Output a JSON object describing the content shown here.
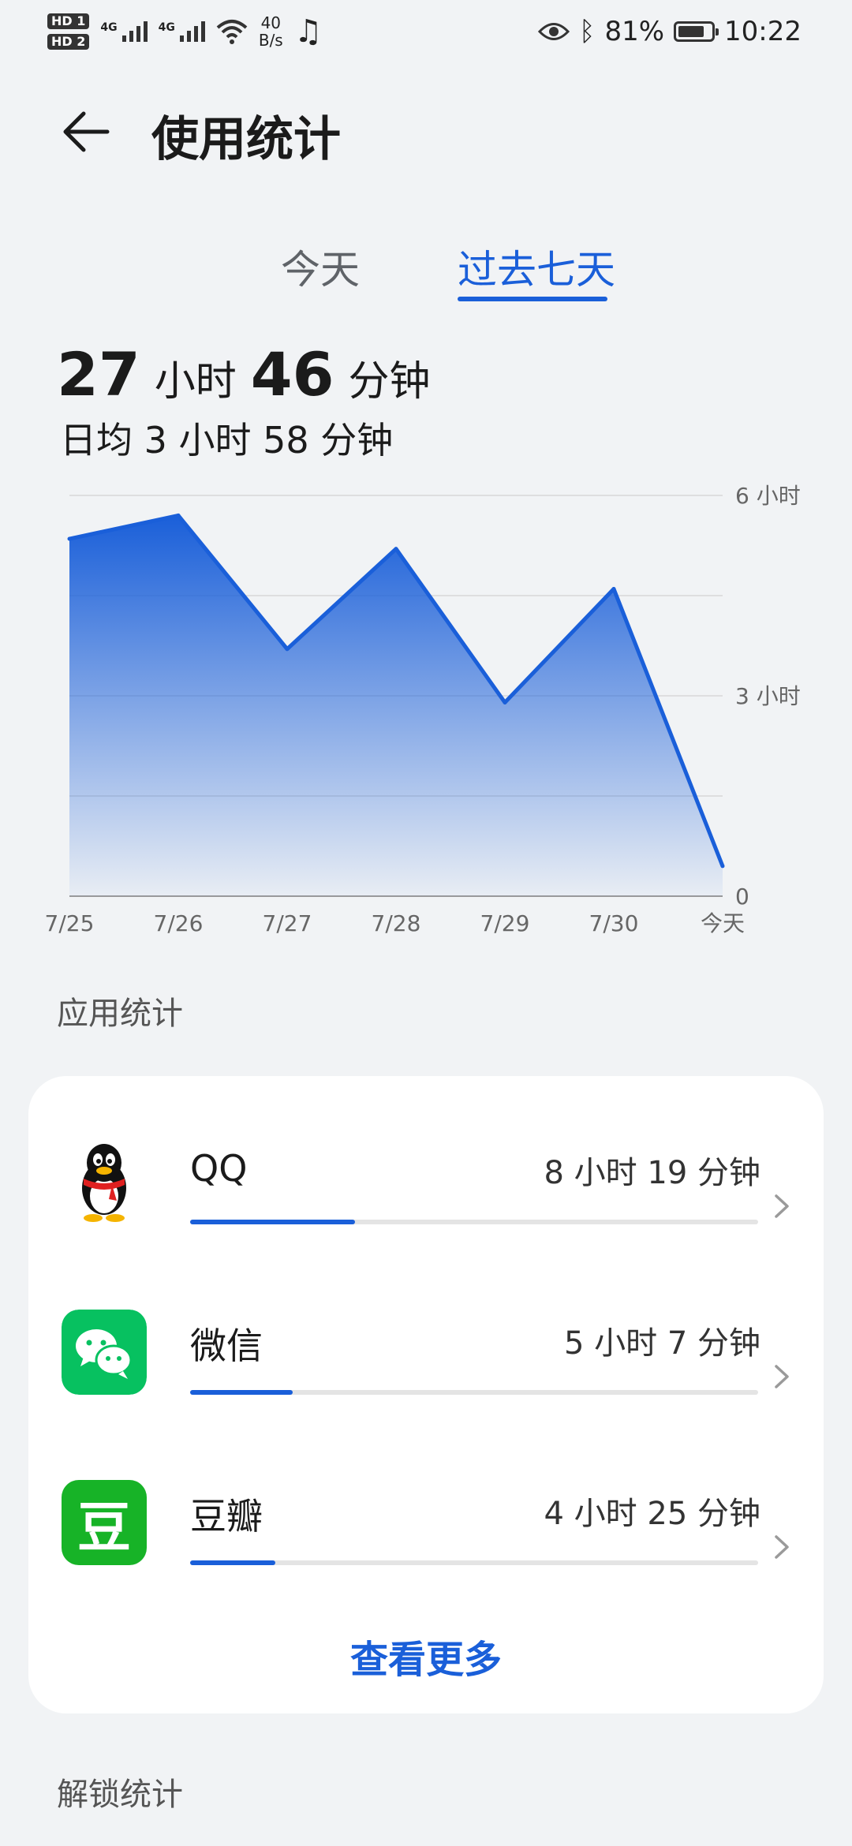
{
  "status_bar": {
    "hd1": "HD 1",
    "hd2": "HD 2",
    "net1": "4G",
    "net2": "4G",
    "speed_value": "40",
    "speed_unit": "B/s",
    "battery_text": "81%",
    "battery_level": 0.81,
    "time": "10:22"
  },
  "header": {
    "title": "使用统计"
  },
  "tabs": [
    {
      "label": "今天",
      "active": false
    },
    {
      "label": "过去七天",
      "active": true
    }
  ],
  "summary": {
    "total_hours": "27",
    "hours_unit": "小时",
    "total_minutes": "46",
    "minutes_unit": "分钟",
    "average": "日均 3 小时 58 分钟"
  },
  "chart_data": {
    "type": "area",
    "categories": [
      "7/25",
      "7/26",
      "7/27",
      "7/28",
      "7/29",
      "7/30",
      "今天"
    ],
    "values": [
      5.35,
      5.7,
      3.7,
      5.2,
      2.9,
      4.6,
      0.45
    ],
    "ylim": [
      0,
      6
    ],
    "yticks": [
      {
        "value": 6,
        "label": "6 小时"
      },
      {
        "value": 3,
        "label": "3 小时"
      },
      {
        "value": 0,
        "label": "0"
      }
    ],
    "gridlines": [
      0,
      1.5,
      3,
      4.5,
      6
    ],
    "color": "#1a5fd9"
  },
  "apps_section": {
    "title": "应用统计",
    "apps": [
      {
        "name": "QQ",
        "time": "8 小时 19 分钟",
        "share": 0.29
      },
      {
        "name": "微信",
        "time": "5 小时 7 分钟",
        "share": 0.18
      },
      {
        "name": "豆瓣",
        "time": "4 小时 25 分钟",
        "share": 0.15
      }
    ],
    "see_more": "查看更多"
  },
  "unlock_section": {
    "title": "解锁统计"
  },
  "icons": {
    "douban_glyph": "豆",
    "music": "♫",
    "bluetooth": "ᛒ"
  },
  "colors": {
    "accent": "#1a5fd9",
    "wechat": "#07c160",
    "douban": "#17b327"
  }
}
